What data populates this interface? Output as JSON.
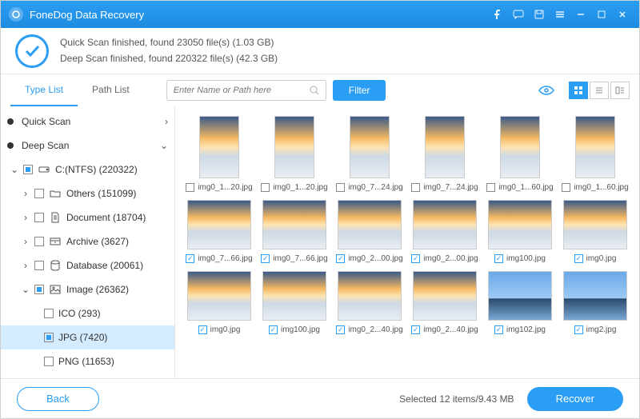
{
  "titlebar": {
    "title": "FoneDog Data Recovery"
  },
  "status": {
    "line1": "Quick Scan finished, found 23050 file(s) (1.03 GB)",
    "line2": "Deep Scan finished, found 220322 file(s) (42.3 GB)"
  },
  "toolbar": {
    "tab_type": "Type List",
    "tab_path": "Path List",
    "search_placeholder": "Enter Name or Path here",
    "filter": "Filter"
  },
  "sidebar": {
    "quick_scan": "Quick Scan",
    "deep_scan": "Deep Scan",
    "drive": "C:(NTFS) (220322)",
    "others": "Others (151099)",
    "document": "Document (18704)",
    "archive": "Archive (3627)",
    "database": "Database (20061)",
    "image": "Image (26362)",
    "ico": "ICO (293)",
    "jpg": "JPG (7420)",
    "png": "PNG (11653)"
  },
  "thumbs": {
    "r1c1": "img0_1...20.jpg",
    "r1c2": "img0_1...20.jpg",
    "r1c3": "img0_7...24.jpg",
    "r1c4": "img0_7...24.jpg",
    "r1c5": "img0_1...60.jpg",
    "r1c6": "img0_1...60.jpg",
    "r2c1": "img0_7...66.jpg",
    "r2c2": "img0_7...66.jpg",
    "r2c3": "img0_2...00.jpg",
    "r2c4": "img0_2...00.jpg",
    "r2c5": "img100.jpg",
    "r2c6": "img0.jpg",
    "r3c1": "img0.jpg",
    "r3c2": "img100.jpg",
    "r3c3": "img0_2...40.jpg",
    "r3c4": "img0_2...40.jpg",
    "r3c5": "img102.jpg",
    "r3c6": "img2.jpg"
  },
  "footer": {
    "back": "Back",
    "selected": "Selected 12 items/9.43 MB",
    "recover": "Recover"
  }
}
